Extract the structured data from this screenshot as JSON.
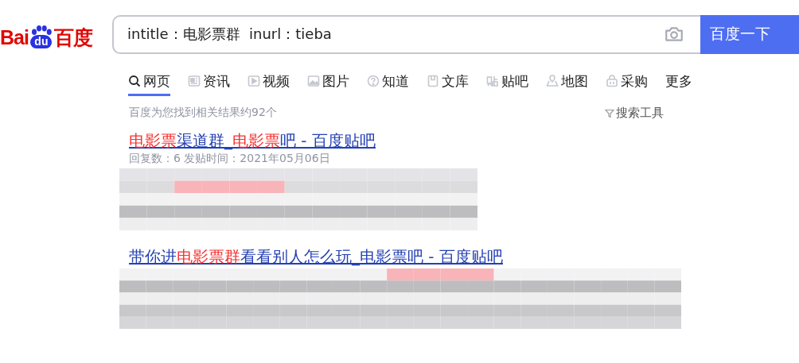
{
  "logo": {
    "left": "Bai",
    "paw": "du",
    "right": "百度"
  },
  "search": {
    "value": "intitle：电影票群  inurl：tieba",
    "button": "百度一下"
  },
  "tabs": [
    {
      "label": "网页",
      "selected": true
    },
    {
      "label": "资讯",
      "selected": false
    },
    {
      "label": "视频",
      "selected": false
    },
    {
      "label": "图片",
      "selected": false
    },
    {
      "label": "知道",
      "selected": false
    },
    {
      "label": "文库",
      "selected": false
    },
    {
      "label": "贴吧",
      "selected": false
    },
    {
      "label": "地图",
      "selected": false
    },
    {
      "label": "采购",
      "selected": false
    },
    {
      "label": "更多",
      "selected": false
    }
  ],
  "result_count": "百度为您找到相关结果约92个",
  "search_tools": "搜索工具",
  "results": [
    {
      "title": [
        {
          "text": "电影票",
          "highlight": true
        },
        {
          "text": "渠道群_",
          "highlight": false
        },
        {
          "text": "电影票",
          "highlight": true
        },
        {
          "text": "吧 - 百度贴吧",
          "highlight": false
        }
      ],
      "meta": "回复数：6 发贴时间：2021年05月06日",
      "kind": "picture"
    },
    {
      "title": [
        {
          "text": "带你进",
          "highlight": false
        },
        {
          "text": "电影票群",
          "highlight": true
        },
        {
          "text": "看看别人怎么玩_电影票吧 - 百度贴吧",
          "highlight": false
        }
      ],
      "kind": "picture"
    }
  ]
}
